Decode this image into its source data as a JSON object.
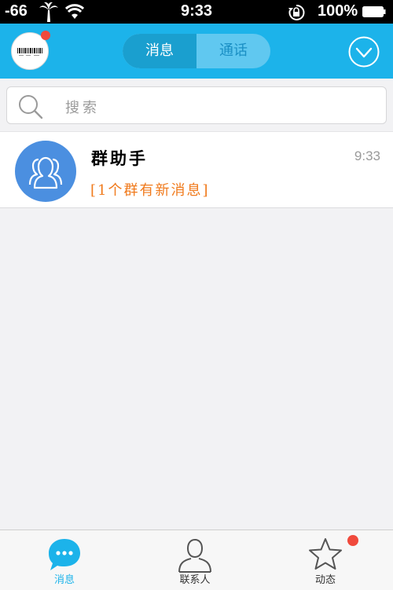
{
  "status_bar": {
    "signal": "-66",
    "time": "9:33",
    "battery": "100%"
  },
  "header": {
    "tabs": [
      {
        "label": "消息",
        "active": true
      },
      {
        "label": "通话",
        "active": false
      }
    ]
  },
  "search": {
    "placeholder": "搜索"
  },
  "conversations": [
    {
      "title": "群助手",
      "time": "9:33",
      "preview": "[1个群有新消息]"
    }
  ],
  "tabbar": {
    "items": [
      {
        "label": "消息",
        "active": true
      },
      {
        "label": "联系人",
        "active": false
      },
      {
        "label": "动态",
        "active": false,
        "badge": true
      }
    ]
  },
  "colors": {
    "accent": "#1cb3ea",
    "badge": "#f04a3c",
    "preview": "#f07a1c",
    "group_avatar": "#4b8fe0"
  }
}
